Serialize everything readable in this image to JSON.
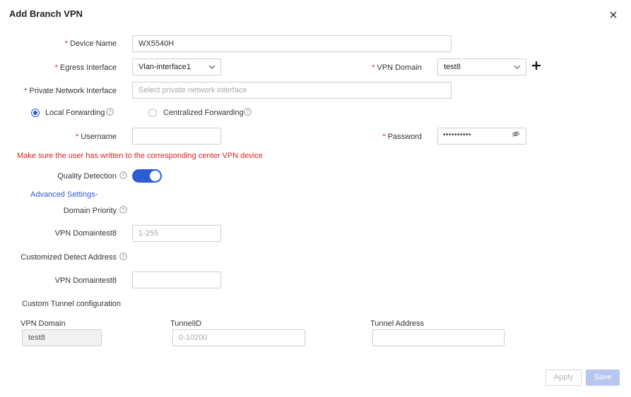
{
  "dialog": {
    "title": "Add Branch VPN",
    "close_icon": "close-icon"
  },
  "form": {
    "device_name": {
      "label": "Device Name",
      "value": "WX5540H"
    },
    "egress_interface": {
      "label": "Egress Interface",
      "value": "Vlan-interface1"
    },
    "vpn_domain": {
      "label": "VPN Domain",
      "value": "test8"
    },
    "private_network_interface": {
      "label": "Private Network Interface",
      "placeholder": "Select private network interface"
    },
    "forwarding": {
      "local_label": "Local Forwarding",
      "centralized_label": "Centralized Forwarding",
      "selected": "local"
    },
    "username": {
      "label": "Username",
      "value": ""
    },
    "password": {
      "label": "Password",
      "masked": "••••••••••"
    },
    "warning": "Make sure the user has written to the corresponding center VPN device",
    "quality_detection": {
      "label": "Quality Detection",
      "enabled": true
    },
    "advanced_settings_link": "Advanced Settings-",
    "domain_priority": {
      "label": "Domain Priority"
    },
    "priority_domain": {
      "label": "VPN Domaintest8",
      "placeholder": "1-255"
    },
    "customized_detect_address": {
      "label": "Customized Detect Address"
    },
    "detect_domain": {
      "label": "VPN Domaintest8",
      "value": ""
    },
    "custom_tunnel": {
      "section_label": "Custom Tunnel configuration",
      "columns": [
        "VPN Domain",
        "TunnelID",
        "Tunnel Address"
      ],
      "row": {
        "vpn_domain": "test8",
        "tunnel_id_placeholder": "0-10200",
        "tunnel_address": ""
      }
    }
  },
  "footer": {
    "apply_label": "Apply",
    "save_label": "Save"
  },
  "colors": {
    "accent": "#2f5bd3",
    "required": "#e02020",
    "save_disabled": "#b7c6ee"
  }
}
